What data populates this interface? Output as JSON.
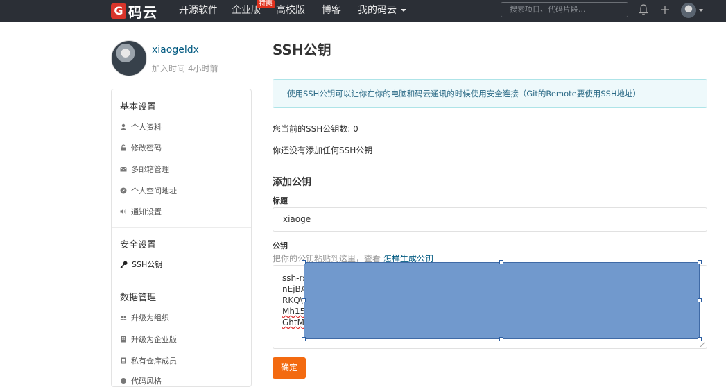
{
  "header": {
    "logo_mark": "G",
    "logo_text": "码云",
    "nav": [
      "开源软件",
      "企业版",
      "高校版",
      "博客",
      "我的码云"
    ],
    "hot_badge": "特惠",
    "search_placeholder": "搜索项目、代码片段..."
  },
  "profile": {
    "username": "xiaogeldx",
    "joined": "加入时间 4小时前"
  },
  "sidebar": {
    "groups": [
      {
        "title": "基本设置",
        "items": [
          {
            "label": "个人资料",
            "icon": "user-icon"
          },
          {
            "label": "修改密码",
            "icon": "lock-icon"
          },
          {
            "label": "多邮箱管理",
            "icon": "mail-icon"
          },
          {
            "label": "个人空间地址",
            "icon": "compass-icon"
          },
          {
            "label": "通知设置",
            "icon": "volume-icon"
          }
        ]
      },
      {
        "title": "安全设置",
        "items": [
          {
            "label": "SSH公钥",
            "icon": "key-icon"
          }
        ]
      },
      {
        "title": "数据管理",
        "items": [
          {
            "label": "升级为组织",
            "icon": "group-icon"
          },
          {
            "label": "升级为企业版",
            "icon": "building-icon"
          },
          {
            "label": "私有仓库成员",
            "icon": "member-icon"
          },
          {
            "label": "代码风格",
            "icon": "code-icon"
          }
        ]
      }
    ]
  },
  "main": {
    "title": "SSH公钥",
    "info": "使用SSH公钥可以让你在你的电脑和码云通讯的时候使用安全连接（Git的Remote要使用SSH地址）",
    "count": "您当前的SSH公钥数: 0",
    "none": "你还没有添加任何SSH公钥",
    "add_title": "添加公钥",
    "title_label": "标题",
    "title_value": "xiaoge",
    "key_label": "公钥",
    "key_hint": "把你的公钥粘贴到这里，查看",
    "key_hint_link": "怎样生成公钥",
    "key_lines": [
      "ssh-rs",
      "nEjBA",
      "RKQ\\",
      "Mh15r",
      "GhtMS"
    ],
    "submit": "确定"
  },
  "colors": {
    "topbar": "#2b2f36",
    "accent": "#f36a10",
    "link": "#005980",
    "overlay": "#7199cd"
  }
}
